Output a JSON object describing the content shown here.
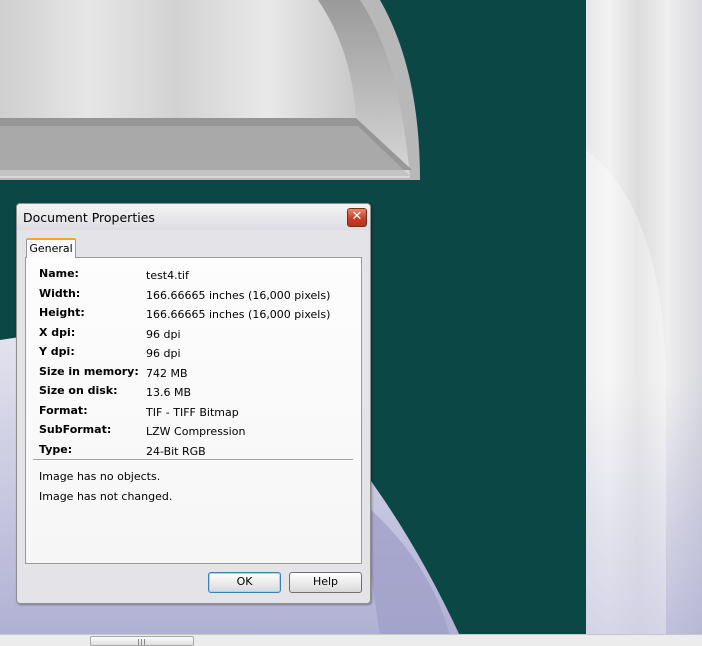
{
  "dialog": {
    "title": "Document Properties",
    "close_label": "✕",
    "tab_general": "General",
    "properties": [
      {
        "label": "Name:",
        "value": "test4.tif"
      },
      {
        "label": "Width:",
        "value": "166.66665 inches  (16,000 pixels)"
      },
      {
        "label": "Height:",
        "value": "166.66665 inches  (16,000 pixels)"
      },
      {
        "label": "X dpi:",
        "value": "96 dpi"
      },
      {
        "label": "Y dpi:",
        "value": "96 dpi"
      },
      {
        "label": "Size in memory:",
        "value": "742 MB"
      },
      {
        "label": "Size on disk:",
        "value": "13.6 MB"
      },
      {
        "label": "Format:",
        "value": "TIF - TIFF Bitmap"
      },
      {
        "label": "SubFormat:",
        "value": "LZW Compression"
      },
      {
        "label": "Type:",
        "value": "24-Bit RGB"
      }
    ],
    "messages": [
      "Image has no objects.",
      "Image has not changed."
    ],
    "ok_label": "OK",
    "help_label": "Help"
  },
  "colors": {
    "desktop_teal": "#0b4744",
    "tab_accent": "#f5a623",
    "close_red": "#c8402a"
  }
}
